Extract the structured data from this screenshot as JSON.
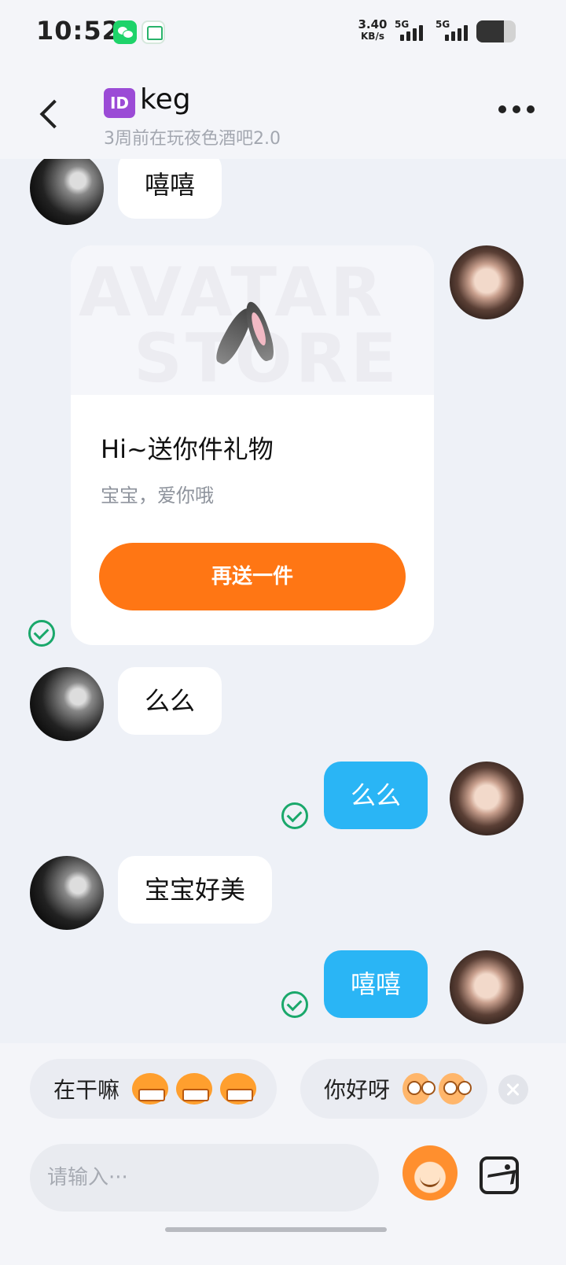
{
  "status_bar": {
    "time": "10:52",
    "net_speed_value": "3.40",
    "net_speed_unit": "KB/s",
    "network_1": "5G",
    "network_2": "5G",
    "battery_level": 0.7,
    "apps": [
      "wechat-icon",
      "home-app-icon"
    ]
  },
  "header": {
    "id_badge": "ID",
    "title": "keg",
    "subtitle": "3周前在玩夜色酒吧2.0"
  },
  "messages": [
    {
      "from": "them",
      "text": "嘻嘻"
    },
    {
      "from": "me",
      "type": "gift",
      "watermark_line1": "AVATAR",
      "watermark_line2": "STORE",
      "gift_item": "rabbit-ears-icon",
      "title": "Hi~送你件礼物",
      "subtitle": "宝宝，爱你哦",
      "button": "再送一件",
      "status": "sent"
    },
    {
      "from": "them",
      "text": "么么"
    },
    {
      "from": "me",
      "text": "么么",
      "status": "sent"
    },
    {
      "from": "them",
      "text": "宝宝好美"
    },
    {
      "from": "me",
      "text": "嘻嘻",
      "status": "sent"
    }
  ],
  "quick_replies": [
    {
      "text": "在干嘛",
      "emoji": "grinning-monkey-emoji"
    },
    {
      "text": "你好呀",
      "emoji": "surprised-monkey-emoji"
    }
  ],
  "input": {
    "placeholder": "请输入···"
  },
  "colors": {
    "accent_orange": "#ff7614",
    "outgoing_bubble": "#2ab5f5",
    "sent_check": "#1aa86b",
    "background": "#eef1f7"
  }
}
